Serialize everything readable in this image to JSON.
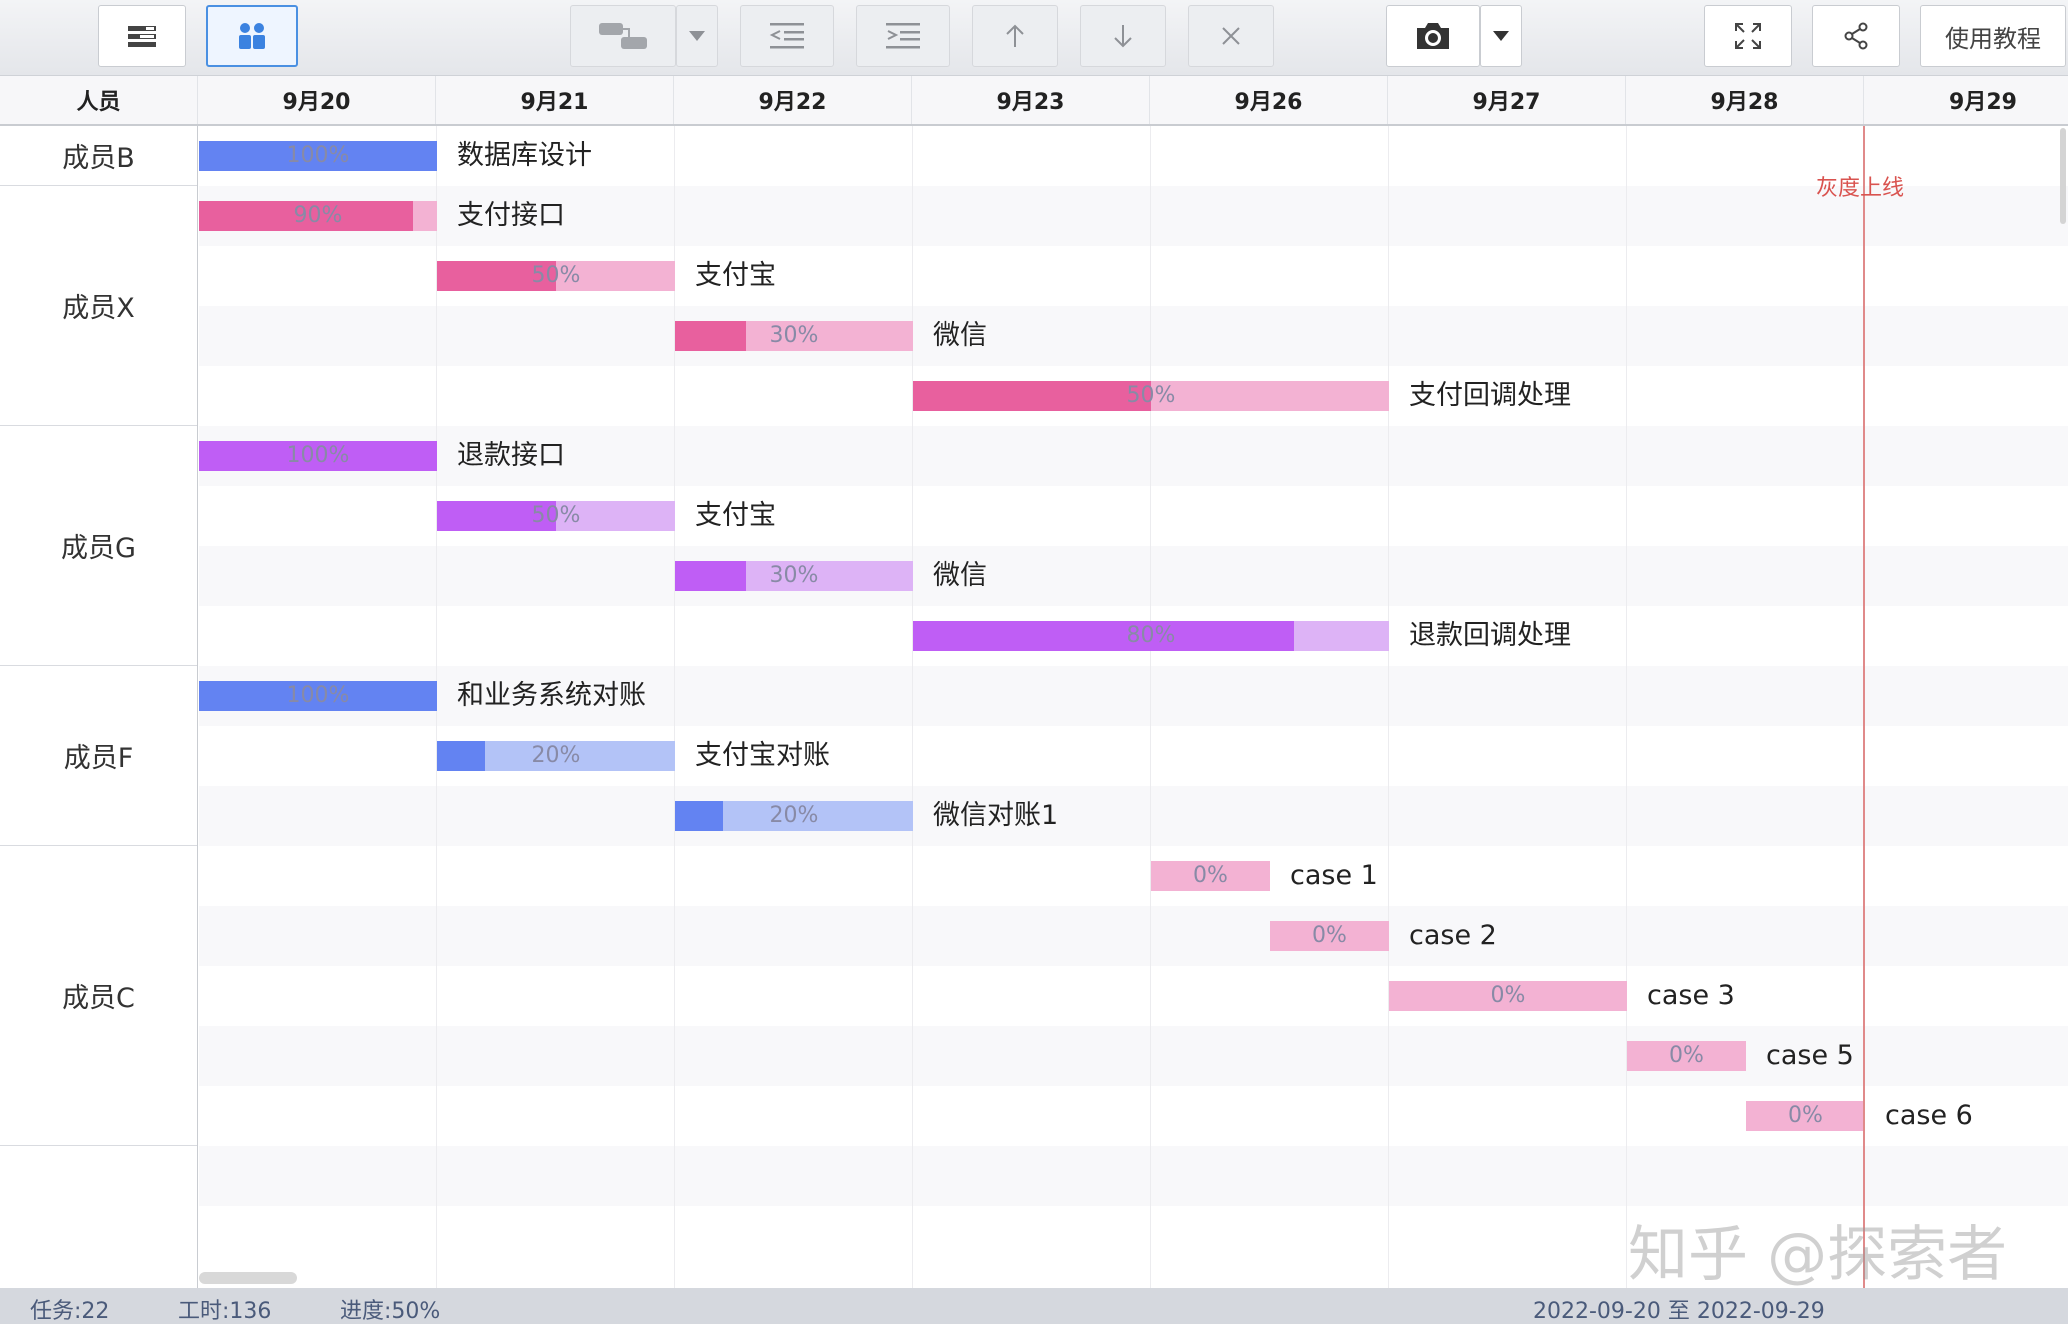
{
  "toolbar": {
    "help_label": "使用教程"
  },
  "header": {
    "person_col": "人员",
    "dates": [
      "9月20",
      "9月21",
      "9月22",
      "9月23",
      "9月26",
      "9月27",
      "9月28",
      "9月29"
    ]
  },
  "members": [
    "成员B",
    "成员X",
    "成员G",
    "成员F",
    "成员C"
  ],
  "tasks": [
    {
      "member": "成员B",
      "name": "数据库设计",
      "start": "9月20",
      "end": "9月20",
      "progress": 100,
      "color": "blue"
    },
    {
      "member": "成员X",
      "name": "支付接口",
      "start": "9月20",
      "end": "9月20",
      "progress": 90,
      "color": "pink"
    },
    {
      "member": "成员X",
      "name": "支付宝",
      "start": "9月21",
      "end": "9月21",
      "progress": 50,
      "color": "pink"
    },
    {
      "member": "成员X",
      "name": "微信",
      "start": "9月22",
      "end": "9月22",
      "progress": 30,
      "color": "pink"
    },
    {
      "member": "成员X",
      "name": "支付回调处理",
      "start": "9月23",
      "end": "9月26",
      "progress": 50,
      "color": "pink"
    },
    {
      "member": "成员G",
      "name": "退款接口",
      "start": "9月20",
      "end": "9月20",
      "progress": 100,
      "color": "purple"
    },
    {
      "member": "成员G",
      "name": "支付宝",
      "start": "9月21",
      "end": "9月21",
      "progress": 50,
      "color": "purple"
    },
    {
      "member": "成员G",
      "name": "微信",
      "start": "9月22",
      "end": "9月22",
      "progress": 30,
      "color": "purple"
    },
    {
      "member": "成员G",
      "name": "退款回调处理",
      "start": "9月23",
      "end": "9月26",
      "progress": 80,
      "color": "purple"
    },
    {
      "member": "成员F",
      "name": "和业务系统对账",
      "start": "9月20",
      "end": "9月20",
      "progress": 100,
      "color": "blue"
    },
    {
      "member": "成员F",
      "name": "支付宝对账",
      "start": "9月21",
      "end": "9月21",
      "progress": 20,
      "color": "blue"
    },
    {
      "member": "成员F",
      "name": "微信对账1",
      "start": "9月22",
      "end": "9月22",
      "progress": 20,
      "color": "blue"
    },
    {
      "member": "成员C",
      "name": "case 1",
      "start": "9月26",
      "end": "9月26",
      "progress": 0,
      "color": "pink"
    },
    {
      "member": "成员C",
      "name": "case 2",
      "start": "9月26",
      "end": "9月26",
      "progress": 0,
      "color": "pink"
    },
    {
      "member": "成员C",
      "name": "case 3",
      "start": "9月27",
      "end": "9月27",
      "progress": 0,
      "color": "pink"
    },
    {
      "member": "成员C",
      "name": "case 5",
      "start": "9月28",
      "end": "9月28",
      "progress": 0,
      "color": "pink"
    },
    {
      "member": "成员C",
      "name": "case 6",
      "start": "9月28",
      "end": "9月28",
      "progress": 0,
      "color": "pink"
    }
  ],
  "milestone": {
    "label": "灰度上线",
    "date": "9月28"
  },
  "colors": {
    "blue": {
      "fill": "#6383f2",
      "track": "#b3c3f7"
    },
    "pink": {
      "fill": "#e8609e",
      "track": "#f3b2d3"
    },
    "purple": {
      "fill": "#bf5ef5",
      "track": "#ddb3f6"
    },
    "milestone": "#d9534f"
  },
  "status": {
    "tasks": "任务:22",
    "hours": "工时:136",
    "progress": "进度:50%",
    "date_range": "2022-09-20 至 2022-09-29"
  },
  "watermark": "知乎 @探索者"
}
